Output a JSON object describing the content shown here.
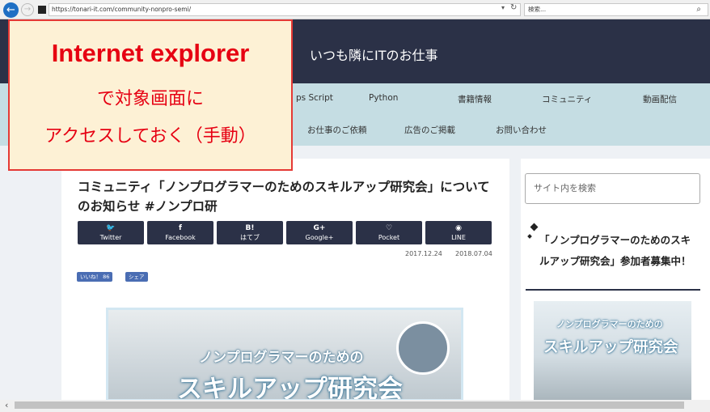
{
  "browser": {
    "url": "https://tonari-it.com/community-nonpro-semi/",
    "search_placeholder": "検索..."
  },
  "site": {
    "title": "いつも隣にITのお仕事"
  },
  "nav": {
    "row1": [
      "ps Script",
      "Python",
      "書籍情報",
      "コミュニティ",
      "動画配信"
    ],
    "row2": [
      "お仕事のご依頼",
      "広告のご掲載",
      "お問い合わせ"
    ]
  },
  "article": {
    "title": "コミュニティ「ノンプログラマーのためのスキルアップ研究会」についてのお知らせ #ノンプロ研",
    "share_buttons": [
      {
        "icon": "twitter-icon",
        "glyph": "🐦",
        "label": "Twitter"
      },
      {
        "icon": "facebook-icon",
        "glyph": "f",
        "label": "Facebook"
      },
      {
        "icon": "hatena-icon",
        "glyph": "B!",
        "label": "はてブ"
      },
      {
        "icon": "google-plus-icon",
        "glyph": "G+",
        "label": "Google+"
      },
      {
        "icon": "pocket-icon",
        "glyph": "♡",
        "label": "Pocket"
      },
      {
        "icon": "line-icon",
        "glyph": "◉",
        "label": "LINE"
      }
    ],
    "date_posted": "2017.12.24",
    "date_updated": "2018.07.04",
    "like_label": "いいね！ 86",
    "share_label": "シェア",
    "eyecatch_sub": "ノンプログラマーのための",
    "eyecatch_main": "スキルアップ研究会"
  },
  "sidebar": {
    "search_placeholder": "サイト内を検索",
    "widget_title": "「ノンプログラマーのためのスキルアップ研究会」参加者募集中！",
    "image_sub": "ノンプログラマーのための",
    "image_main": "スキルアップ研究会"
  },
  "callout": {
    "line1": "Internet explorer",
    "line2": "で対象画面に",
    "line3": "アクセスしておく（手動）"
  },
  "colors": {
    "header_bg": "#2b3147",
    "nav_bg": "#c5dde3",
    "callout_text": "#e60012",
    "callout_border": "#e53935",
    "callout_bg": "#fdf1d5"
  }
}
